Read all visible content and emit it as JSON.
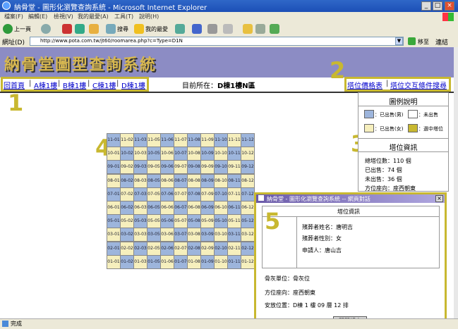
{
  "window": {
    "title": "納骨堂 - 圖形化瀏覽查詢系統 - Microsoft Internet Explorer",
    "buttons": [
      "_",
      "□",
      "×"
    ]
  },
  "menu": [
    "檔案(F)",
    "編輯(E)",
    "檢視(V)",
    "我的最愛(A)",
    "工具(T)",
    "說明(H)"
  ],
  "toolbar": {
    "back": "上一頁",
    "search": "搜尋",
    "favorites": "我的最愛"
  },
  "address": {
    "label": "網址(D)",
    "url": "http://www.pota.com.tw/jt60/roomarea.php?c=Type=D1N",
    "go": "移至",
    "links": "連結"
  },
  "header": {
    "logo": "納骨堂圖型查詢系統"
  },
  "nav": {
    "home": "回首頁",
    "a": "A棟1樓",
    "b": "B棟1樓",
    "c": "C棟1樓",
    "d": "D棟1樓",
    "location_label": "目前所在：",
    "location_value": "D棟1樓N區",
    "price": "塔位價格表",
    "search": "塔位交互條件搜尋"
  },
  "markers": {
    "m1": "1",
    "m2": "2",
    "m3": "3",
    "m4": "4",
    "m5": "5"
  },
  "legend": {
    "title": "圖例說明",
    "sold_male": "：已出售(男)",
    "unsold": "：未出售",
    "sold_female": "：已出售(女)",
    "selected": "：選中塔位",
    "info_title": "塔位資訊",
    "total": "總塔位數：110 個",
    "sold": "已出售：74 個",
    "unsold_count": "未出售：36 個",
    "direction": "方位座向：座西朝東"
  },
  "colors": {
    "male": "#9db5dc",
    "female": "#f6efbd",
    "unsold": "#ffffff",
    "selected": "#c8b830",
    "header": "#8c8cc4"
  },
  "grid": {
    "rows": [
      {
        "label": "11",
        "cells": [
          "11-01",
          "11-02",
          "11-03",
          "11-05",
          "11-06",
          "11-07",
          "11-08",
          "11-09",
          "11-10",
          "11-11",
          "11-12"
        ],
        "types": "MFMFMFMFMFM"
      },
      {
        "label": "10",
        "cells": [
          "10-01",
          "10-02",
          "10-03",
          "10-05",
          "10-06",
          "10-07",
          "10-08",
          "10-09",
          "10-10",
          "10-11",
          "10-12"
        ],
        "types": "FMFMFMFMFMF"
      },
      {
        "label": "09",
        "cells": [
          "09-01",
          "09-02",
          "09-03",
          "09-05",
          "09-06",
          "09-07",
          "09-08",
          "09-09",
          "09-10",
          "09-11",
          "09-12"
        ],
        "types": "MFMFMFMFMFM"
      },
      {
        "label": "08",
        "cells": [
          "08-01",
          "08-02",
          "08-03",
          "08-05",
          "08-06",
          "08-07",
          "08-08",
          "08-09",
          "08-10",
          "08-11",
          "08-12"
        ],
        "types": "FMFMFMFMFMF"
      },
      {
        "label": "07",
        "cells": [
          "07-01",
          "07-02",
          "07-03",
          "07-05",
          "07-06",
          "07-07",
          "07-08",
          "07-09",
          "07-10",
          "07-11",
          "07-12"
        ],
        "types": "MFMFMFMFMFM"
      },
      {
        "label": "06",
        "cells": [
          "06-01",
          "06-02",
          "06-03",
          "06-05",
          "06-06",
          "06-07",
          "06-08",
          "06-09",
          "06-10",
          "06-11",
          "06-12"
        ],
        "types": "FMFMFMFMFMF"
      },
      {
        "label": "05",
        "cells": [
          "05-01",
          "05-02",
          "05-03",
          "05-05",
          "05-06",
          "05-07",
          "05-08",
          "05-09",
          "05-10",
          "05-11",
          "05-12"
        ],
        "types": "MFMFMFMFMFM"
      },
      {
        "label": "03",
        "cells": [
          "03-01",
          "03-02",
          "03-03",
          "03-05",
          "03-06",
          "03-07",
          "03-08",
          "03-09",
          "03-10",
          "03-11",
          "03-12"
        ],
        "types": "FMFMFMFMFMF"
      },
      {
        "label": "02",
        "cells": [
          "02-01",
          "02-02",
          "02-03",
          "02-05",
          "02-06",
          "02-07",
          "02-08",
          "02-09",
          "02-10",
          "02-11",
          "02-12"
        ],
        "types": "MFMFMFMFMFM"
      },
      {
        "label": "01",
        "cells": [
          "01-01",
          "01-02",
          "01-03",
          "01-05",
          "01-06",
          "01-07",
          "01-08",
          "01-09",
          "01-10",
          "01-11",
          "01-12"
        ],
        "types": "FMFMFMFMFMF"
      }
    ]
  },
  "dialog": {
    "title": "納骨堂 - 圖形化瀏覽查詢系統 -- 網頁對話",
    "close_x": "×",
    "section_title": "塔位資訊",
    "name": "殯葬者姓名：唐明吉",
    "gender": "殯葬者性別：女",
    "applicant": "申請人：唐山吉",
    "unit": "骨灰單位：骨灰位",
    "direction": "方位座向：座西朝東",
    "position": "安放位置：D棟 1 樓 09 層 12 排",
    "close_button": "關閉視窗"
  },
  "status": {
    "text": "完成"
  }
}
